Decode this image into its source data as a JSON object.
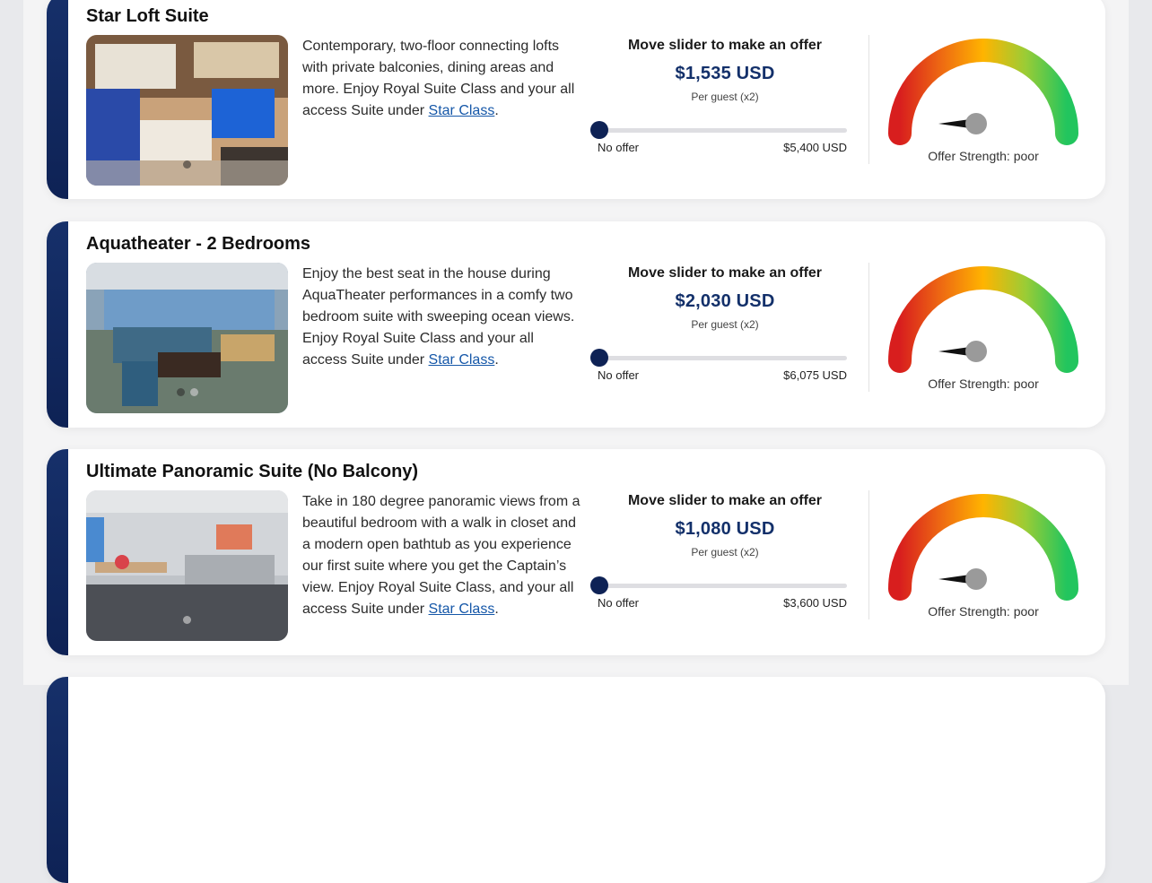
{
  "offer_heading": "Move slider to make an offer",
  "colors": {
    "accent": "#0e2255",
    "link": "#1557a8",
    "gauge_red": "#d81e1e",
    "gauge_yellow": "#ffb400",
    "gauge_green": "#22c55e"
  },
  "suites": [
    {
      "title": "Star Loft Suite",
      "desc_text": "Contemporary, two-floor connecting lofts with private balconies, dining areas and more. Enjoy Royal Suite Class and your all access Suite under ",
      "link_label": "Star Class",
      "desc_end": ".",
      "offer_amount": "$1,535 USD",
      "per_guest": "Per guest (x2)",
      "slider_min_label": "No offer",
      "slider_max_label": "$5,400 USD",
      "gauge_label": "Offer Strength: poor",
      "image_dots": 1
    },
    {
      "title": "Aquatheater - 2 Bedrooms",
      "desc_text": "Enjoy the best seat in the house during AquaTheater performances in a comfy two bedroom suite with sweeping ocean views. Enjoy Royal Suite Class and your all access Suite under ",
      "link_label": "Star Class",
      "desc_end": ".",
      "offer_amount": "$2,030 USD",
      "per_guest": "Per guest (x2)",
      "slider_min_label": "No offer",
      "slider_max_label": "$6,075 USD",
      "gauge_label": "Offer Strength: poor",
      "image_dots": 2
    },
    {
      "title": "Ultimate Panoramic Suite (No Balcony)",
      "desc_text": "Take in 180 degree panoramic views from a beautiful bedroom with a walk in closet and a modern open bathtub as you experience our first suite where you get the Captain’s view. Enjoy Royal Suite Class, and your all access Suite under ",
      "link_label": "Star Class",
      "desc_end": ".",
      "offer_amount": "$1,080 USD",
      "per_guest": "Per guest (x2)",
      "slider_min_label": "No offer",
      "slider_max_label": "$3,600 USD",
      "gauge_label": "Offer Strength: poor",
      "image_dots": 1
    }
  ]
}
